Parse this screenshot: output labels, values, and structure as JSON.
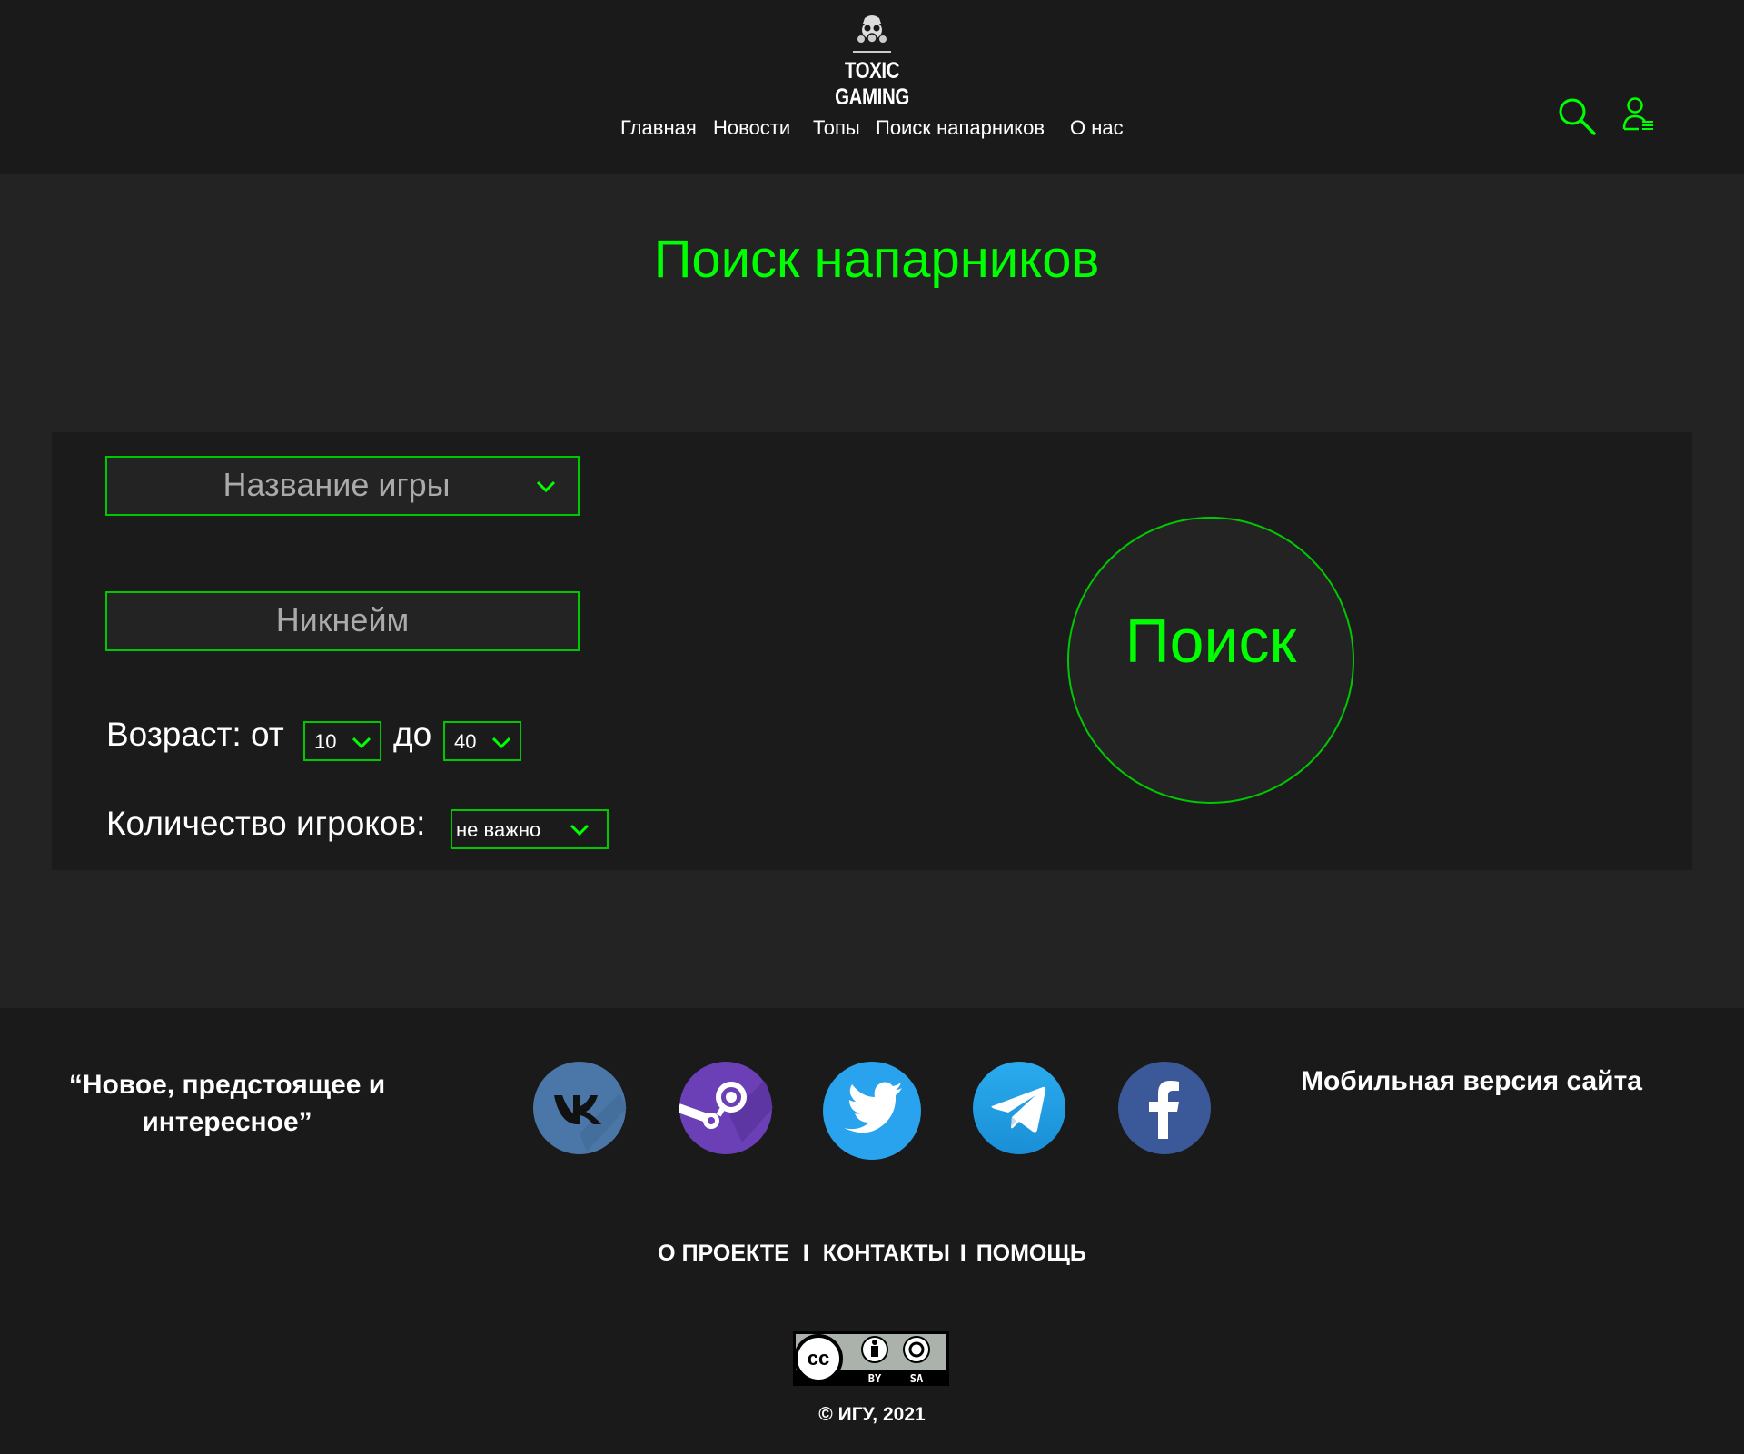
{
  "colors": {
    "accent": "#00ff00",
    "border_green": "#00c800",
    "header_bg": "#1a1a1a",
    "page_bg": "#232323",
    "panel_bg": "#1b1b1b"
  },
  "brand": {
    "name": "TOXIC GAMING",
    "logo_icon": "gas-mask-icon"
  },
  "nav": {
    "items": [
      {
        "label": "Главная"
      },
      {
        "label": "Новости"
      },
      {
        "label": "Топы"
      },
      {
        "label": "Поиск напарников"
      },
      {
        "label": "О нас"
      }
    ]
  },
  "header_icons": {
    "search": "search-icon",
    "user": "user-menu-icon"
  },
  "page": {
    "title": "Поиск напарников"
  },
  "form": {
    "game_placeholder": "Название игры",
    "nickname_placeholder": "Никнейм",
    "age_label": "Возраст: от",
    "age_to_label": "до",
    "age_from_value": "10",
    "age_to_value": "40",
    "players_label": "Количество игроков:",
    "players_value": "не важно",
    "search_button": "Поиск"
  },
  "footer": {
    "quote_line1": "“Новое, предстоящее и",
    "quote_line2": "интересное”",
    "mobile_link": "Мобильная версия сайта",
    "social": [
      {
        "name": "vk-icon",
        "color": "#4a76a8"
      },
      {
        "name": "steam-icon",
        "color": "#6b3fb5"
      },
      {
        "name": "twitter-icon",
        "color": "#2aa3ef"
      },
      {
        "name": "telegram-icon",
        "color": "#1e9be3"
      },
      {
        "name": "facebook-icon",
        "color": "#3b5998"
      }
    ],
    "links": {
      "about": "О ПРОЕКТЕ",
      "sep1": "I",
      "contacts": "КОНТАКТЫ",
      "sep2": "I",
      "help": "ПОМОЩЬ"
    },
    "license": {
      "cc": "cc",
      "by": "BY",
      "sa": "SA"
    },
    "copyright": "© ИГУ, 2021"
  }
}
